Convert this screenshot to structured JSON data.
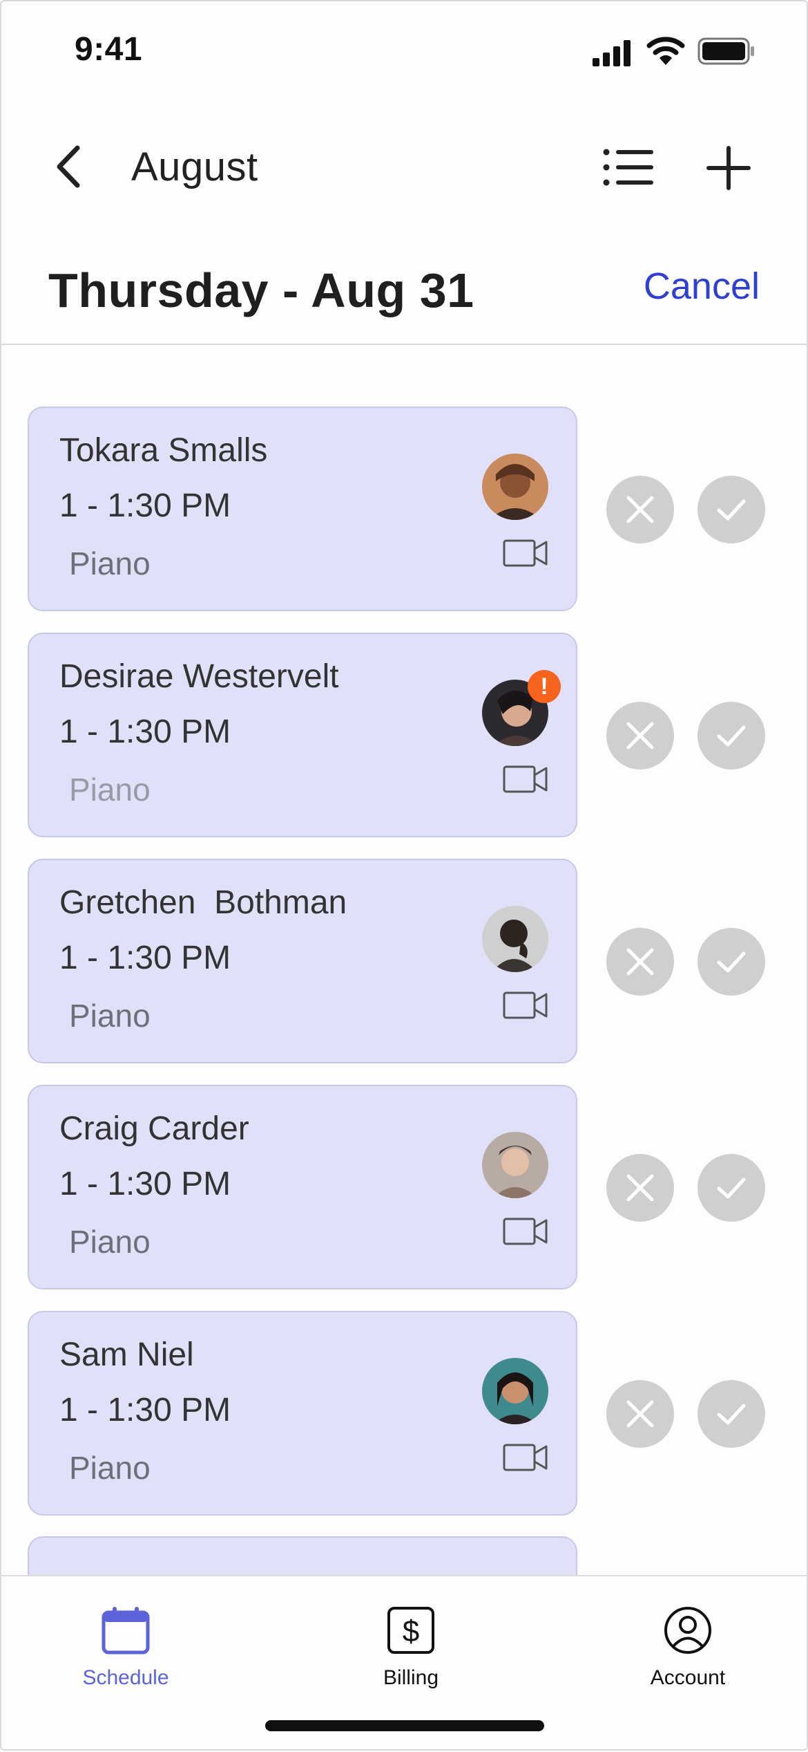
{
  "status_bar": {
    "time": "9:41"
  },
  "nav": {
    "back_icon": "chevron-left-icon",
    "title": "August"
  },
  "header": {
    "date_title": "Thursday - Aug 31",
    "cancel_label": "Cancel"
  },
  "colors": {
    "accent": "#2e3fd1",
    "card_background": "#e0e1f8",
    "action_button": "#cfcfd2",
    "alert_badge": "#f5631c",
    "tab_active": "#5b63d6"
  },
  "requests": [
    {
      "name": "Tokara Smalls",
      "time": "1 - 1:30 PM",
      "subject": "Piano",
      "has_alert": false
    },
    {
      "name": "Desirae Westervelt",
      "time": "1 - 1:30 PM",
      "subject": "Piano",
      "has_alert": true,
      "alert_symbol": "!"
    },
    {
      "name": "Gretchen  Bothman",
      "time": "1 - 1:30 PM",
      "subject": "Piano",
      "has_alert": false
    },
    {
      "name": "Craig Carder",
      "time": "1 - 1:30 PM",
      "subject": "Piano",
      "has_alert": false
    },
    {
      "name": "Sam Niel",
      "time": "1 - 1:30 PM",
      "subject": "Piano",
      "has_alert": false
    }
  ],
  "tabs": [
    {
      "label": "Schedule",
      "icon": "calendar-icon",
      "active": true
    },
    {
      "label": "Billing",
      "icon": "dollar-icon",
      "active": false
    },
    {
      "label": "Account",
      "icon": "user-circle-icon",
      "active": false
    }
  ]
}
